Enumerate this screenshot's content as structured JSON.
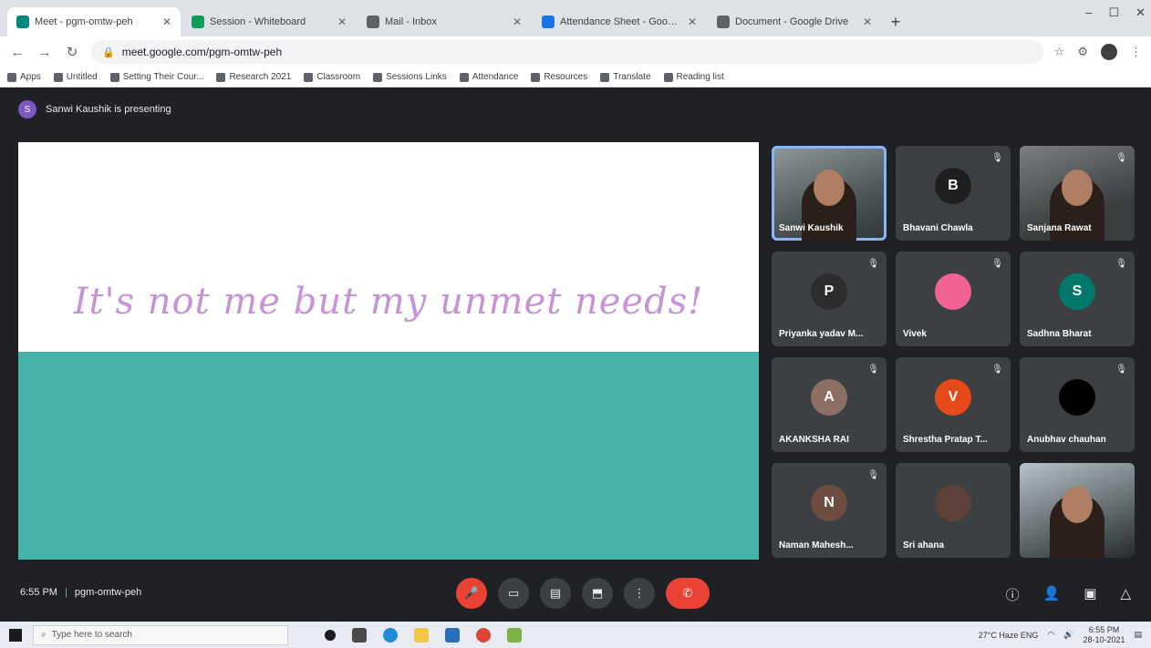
{
  "browser": {
    "tabs": [
      {
        "label": "Meet - pgm-omtw-peh",
        "active": true,
        "color": "#00897b"
      },
      {
        "label": "Session - Whiteboard",
        "active": false,
        "color": "#0f9d58"
      },
      {
        "label": "Mail - Inbox",
        "active": false,
        "color": "#5f6368"
      },
      {
        "label": "Attendance Sheet - Google Sheets",
        "active": false,
        "color": "#1a73e8"
      },
      {
        "label": "Document - Google Drive",
        "active": false,
        "color": "#5f6368"
      }
    ],
    "new_tab": "+",
    "window_controls": {
      "minimize": "–",
      "maximize": "☐",
      "close": "✕"
    },
    "url": "meet.google.com/pgm-omtw-peh",
    "bookmarks": [
      "Apps",
      "Untitled",
      "Setting Their Cour...",
      "Research 2021",
      "Classroom",
      "Sessions Links",
      "Attendance",
      "Resources",
      "Translate",
      "Reading list"
    ]
  },
  "meet": {
    "presenter_initial": "S",
    "presenting_text": "Sanwi Kaushik is presenting",
    "slide_title": "It's not me but my unmet needs!",
    "participants": [
      {
        "name": "Sanwi Kaushik",
        "type": "video",
        "speaking": true
      },
      {
        "name": "Bhavani Chawla",
        "type": "avatar",
        "initial": "B",
        "color": "#1f1f1f",
        "muted": true
      },
      {
        "name": "Sanjana Rawat",
        "type": "video2",
        "muted": true
      },
      {
        "name": "Priyanka yadav M...",
        "type": "avatar",
        "initial": "P",
        "color": "#2d2d2d",
        "muted": true
      },
      {
        "name": "Vivek",
        "type": "avatar",
        "initial": "",
        "color": "#f06292",
        "muted": true
      },
      {
        "name": "Sadhna Bharat",
        "type": "avatar",
        "initial": "S",
        "color": "#00796b",
        "muted": true
      },
      {
        "name": "AKANKSHA RAI",
        "type": "avatar",
        "initial": "A",
        "color": "#8d6e63",
        "muted": true
      },
      {
        "name": "Shrestha Pratap T...",
        "type": "avatar",
        "initial": "V",
        "color": "#e64a19",
        "muted": true
      },
      {
        "name": "Anubhav chauhan",
        "type": "avatar",
        "initial": "",
        "color": "#000000",
        "muted": true
      },
      {
        "name": "Naman Mahesh...",
        "type": "avatar",
        "initial": "N",
        "color": "#6d4c41",
        "muted": true
      },
      {
        "name": "Sri ahana",
        "type": "avatar",
        "initial": "",
        "color": "#5d4037",
        "muted": false
      },
      {
        "name": "",
        "type": "video3",
        "muted": false
      }
    ],
    "mic_muted_icon": "🎙",
    "time": "6:55 PM",
    "separator": "|",
    "meeting_code": "pgm-omtw-peh",
    "controls": {
      "mic": "🎤",
      "camera": "▭",
      "captions": "▤",
      "present": "⬒",
      "more": "⋮",
      "hangup": "✆"
    },
    "right_controls": {
      "info": "ⓘ",
      "people": "👤",
      "chat": "▣",
      "activities": "△"
    }
  },
  "taskbar": {
    "search_placeholder": "Type here to search",
    "tray_text": "27°C Haze  ENG",
    "clock_time": "6:55 PM",
    "clock_date": "28-10-2021"
  }
}
